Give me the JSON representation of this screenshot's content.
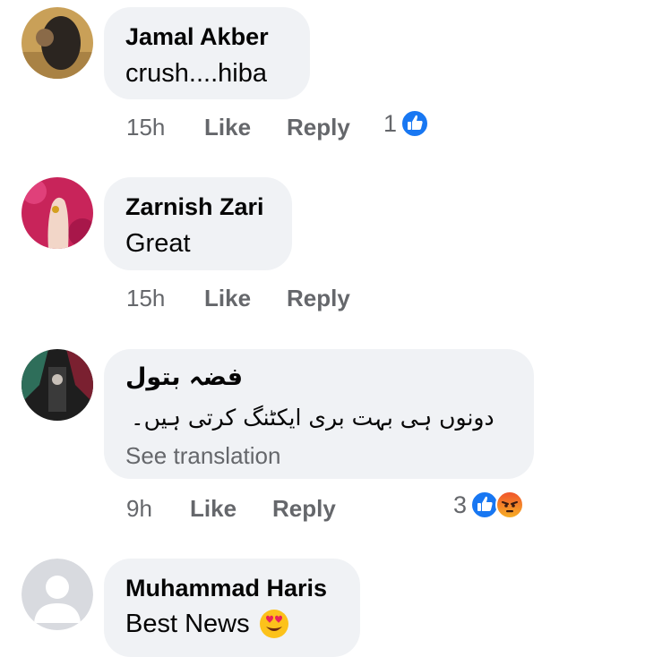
{
  "comments": [
    {
      "author": "Jamal Akber",
      "text": "crush....hiba",
      "time": "15h",
      "like_label": "Like",
      "reply_label": "Reply",
      "reaction_count": "1",
      "reactions": [
        "like-icon"
      ]
    },
    {
      "author": "Zarnish Zari",
      "text": "Great",
      "time": "15h",
      "like_label": "Like",
      "reply_label": "Reply"
    },
    {
      "author": "فضہ بتول",
      "text": "دونوں ہی بہت بری ایکٹنگ کرتی ہیں۔",
      "see_translation": "See translation",
      "time": "9h",
      "like_label": "Like",
      "reply_label": "Reply",
      "reaction_count": "3",
      "reactions": [
        "like-icon",
        "angry-icon"
      ]
    },
    {
      "author": "Muhammad Haris",
      "text": "Best News",
      "text_emoji": "heart-eyes-emoji"
    }
  ],
  "colors": {
    "bubble": "#f0f2f5",
    "meta_text": "#65676b",
    "like_blue": "#1877f2",
    "angry_orange": "#f0522c"
  }
}
